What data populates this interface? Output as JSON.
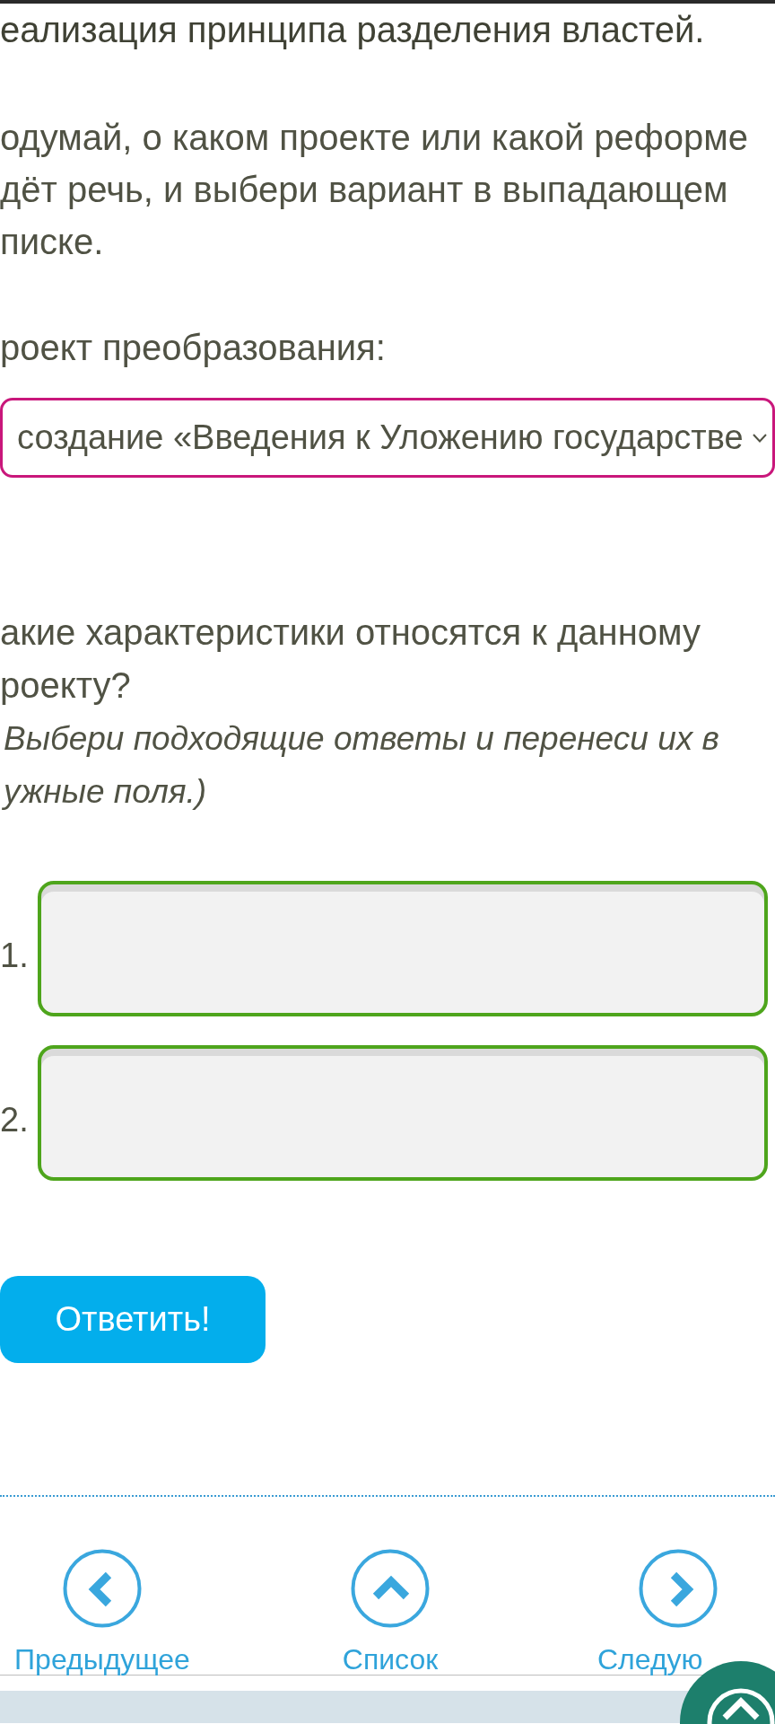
{
  "text_top": "еализация принципа разделения властей.",
  "instruction": "одумай, о каком проекте или какой реформе\nдёт речь, и выбери вариант в выпадающем\nписке.",
  "dropdown": {
    "label": "роект преобразования:",
    "value": "создание «Введения к Уложению государстве"
  },
  "question": {
    "text": "акие характеристики относятся к данному\nроекту?",
    "hint": "Выбери подходящие ответы и перенеси их в\nужные поля.)"
  },
  "answer_fields": [
    {
      "number": "1."
    },
    {
      "number": "2."
    }
  ],
  "submit_button": "Ответить!",
  "navigation": [
    {
      "kind": "previous",
      "label": "Предыдущее"
    },
    {
      "kind": "list",
      "label": "Список"
    },
    {
      "kind": "next",
      "label": "Следую"
    }
  ]
}
